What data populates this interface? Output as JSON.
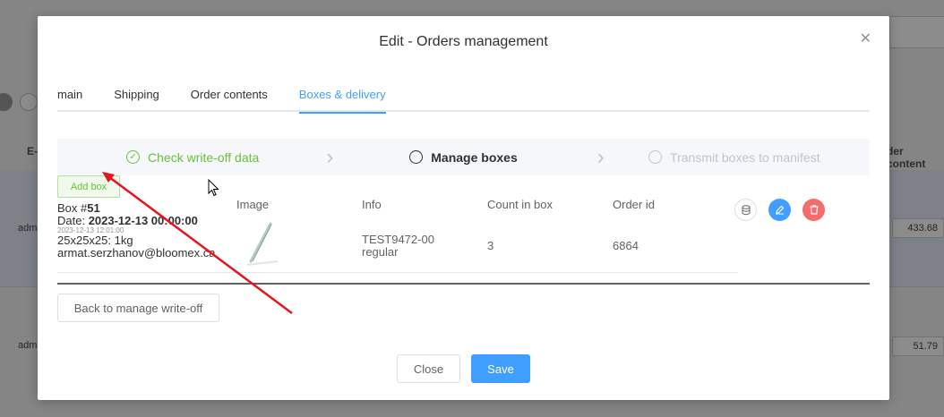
{
  "background": {
    "col_e": "E-",
    "col_order_content": "der content",
    "rows": [
      {
        "user": "admi",
        "value": "433.68"
      },
      {
        "user": "admi",
        "value": "51.79"
      }
    ]
  },
  "modal": {
    "title": "Edit - Orders management",
    "tabs": [
      {
        "label": "main",
        "active": false
      },
      {
        "label": "Shipping",
        "active": false
      },
      {
        "label": "Order contents",
        "active": false
      },
      {
        "label": "Boxes & delivery",
        "active": true
      }
    ],
    "steps": [
      {
        "label": "Check write-off data",
        "status": "done"
      },
      {
        "label": "Manage boxes",
        "status": "current"
      },
      {
        "label": "Transmit boxes to manifest",
        "status": "wait"
      }
    ],
    "add_box_label": "Add box",
    "box": {
      "label_prefix": "Box #",
      "number": "51",
      "date_label": "Date: ",
      "date_value": "2023-12-13 00:00:00",
      "created_small": "2023-12-13 12:01:00",
      "dimensions": "25x25x25: 1kg",
      "email": "armat.serzhanov@bloomex.ca"
    },
    "table": {
      "headers": {
        "image": "Image",
        "info": "Info",
        "count": "Count in box",
        "order_id": "Order id"
      },
      "row": {
        "info_line1": "TEST9472-00",
        "info_line2": "regular",
        "count": "3",
        "order_id": "6864"
      }
    },
    "back_button": "Back to manage write-off",
    "close_button": "Close",
    "save_button": "Save"
  },
  "colors": {
    "primary": "#409eff",
    "success": "#67c23a",
    "danger": "#f56c6c",
    "annotation_arrow": "#e8141c"
  }
}
